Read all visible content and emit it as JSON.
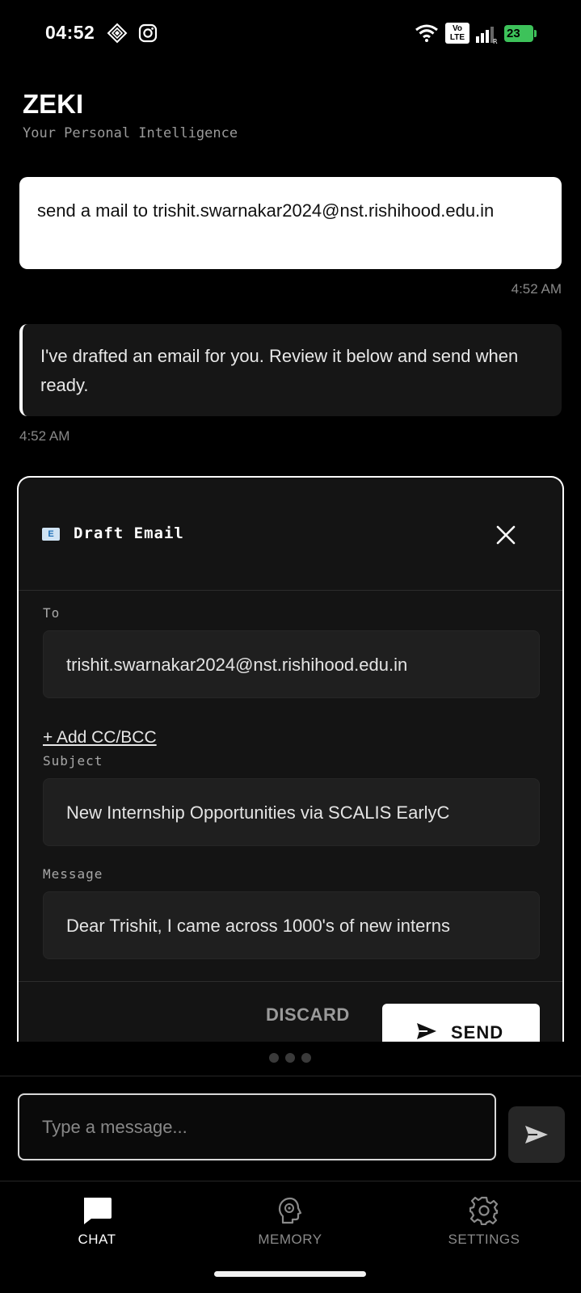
{
  "status_bar": {
    "time": "04:52",
    "volte_top": "Vo",
    "volte_bottom": "LTE",
    "signal_sub": "R",
    "battery": "23"
  },
  "header": {
    "title": "ZEKI",
    "subtitle": "Your Personal Intelligence"
  },
  "messages": [
    {
      "role": "user",
      "text": "send a mail to trishit.swarnakar2024@nst.rishihood.edu.in",
      "time": "4:52 AM"
    },
    {
      "role": "assistant",
      "text": "I've drafted an email for you. Review it below and send when ready.",
      "time": "4:52 AM"
    }
  ],
  "draft": {
    "title": "Draft Email",
    "icon": "email-icon",
    "to_label": "To",
    "to_value": "trishit.swarnakar2024@nst.rishihood.edu.in",
    "add_cc_label": "+ Add CC/BCC",
    "subject_label": "Subject",
    "subject_value": "New Internship Opportunities via SCALIS EarlyC",
    "message_label": "Message",
    "message_value": "Dear Trishit, I came across 1000's of new interns",
    "discard_label": "DISCARD",
    "send_label": "SEND"
  },
  "composer": {
    "placeholder": "Type a message..."
  },
  "nav": {
    "items": [
      {
        "label": "CHAT",
        "icon": "chat-icon",
        "active": true
      },
      {
        "label": "MEMORY",
        "icon": "brain-icon",
        "active": false
      },
      {
        "label": "SETTINGS",
        "icon": "gear-icon",
        "active": false
      }
    ]
  },
  "colors": {
    "background": "#000000",
    "card": "#141414",
    "accent": "#ffffff",
    "battery": "#3dc25a"
  }
}
